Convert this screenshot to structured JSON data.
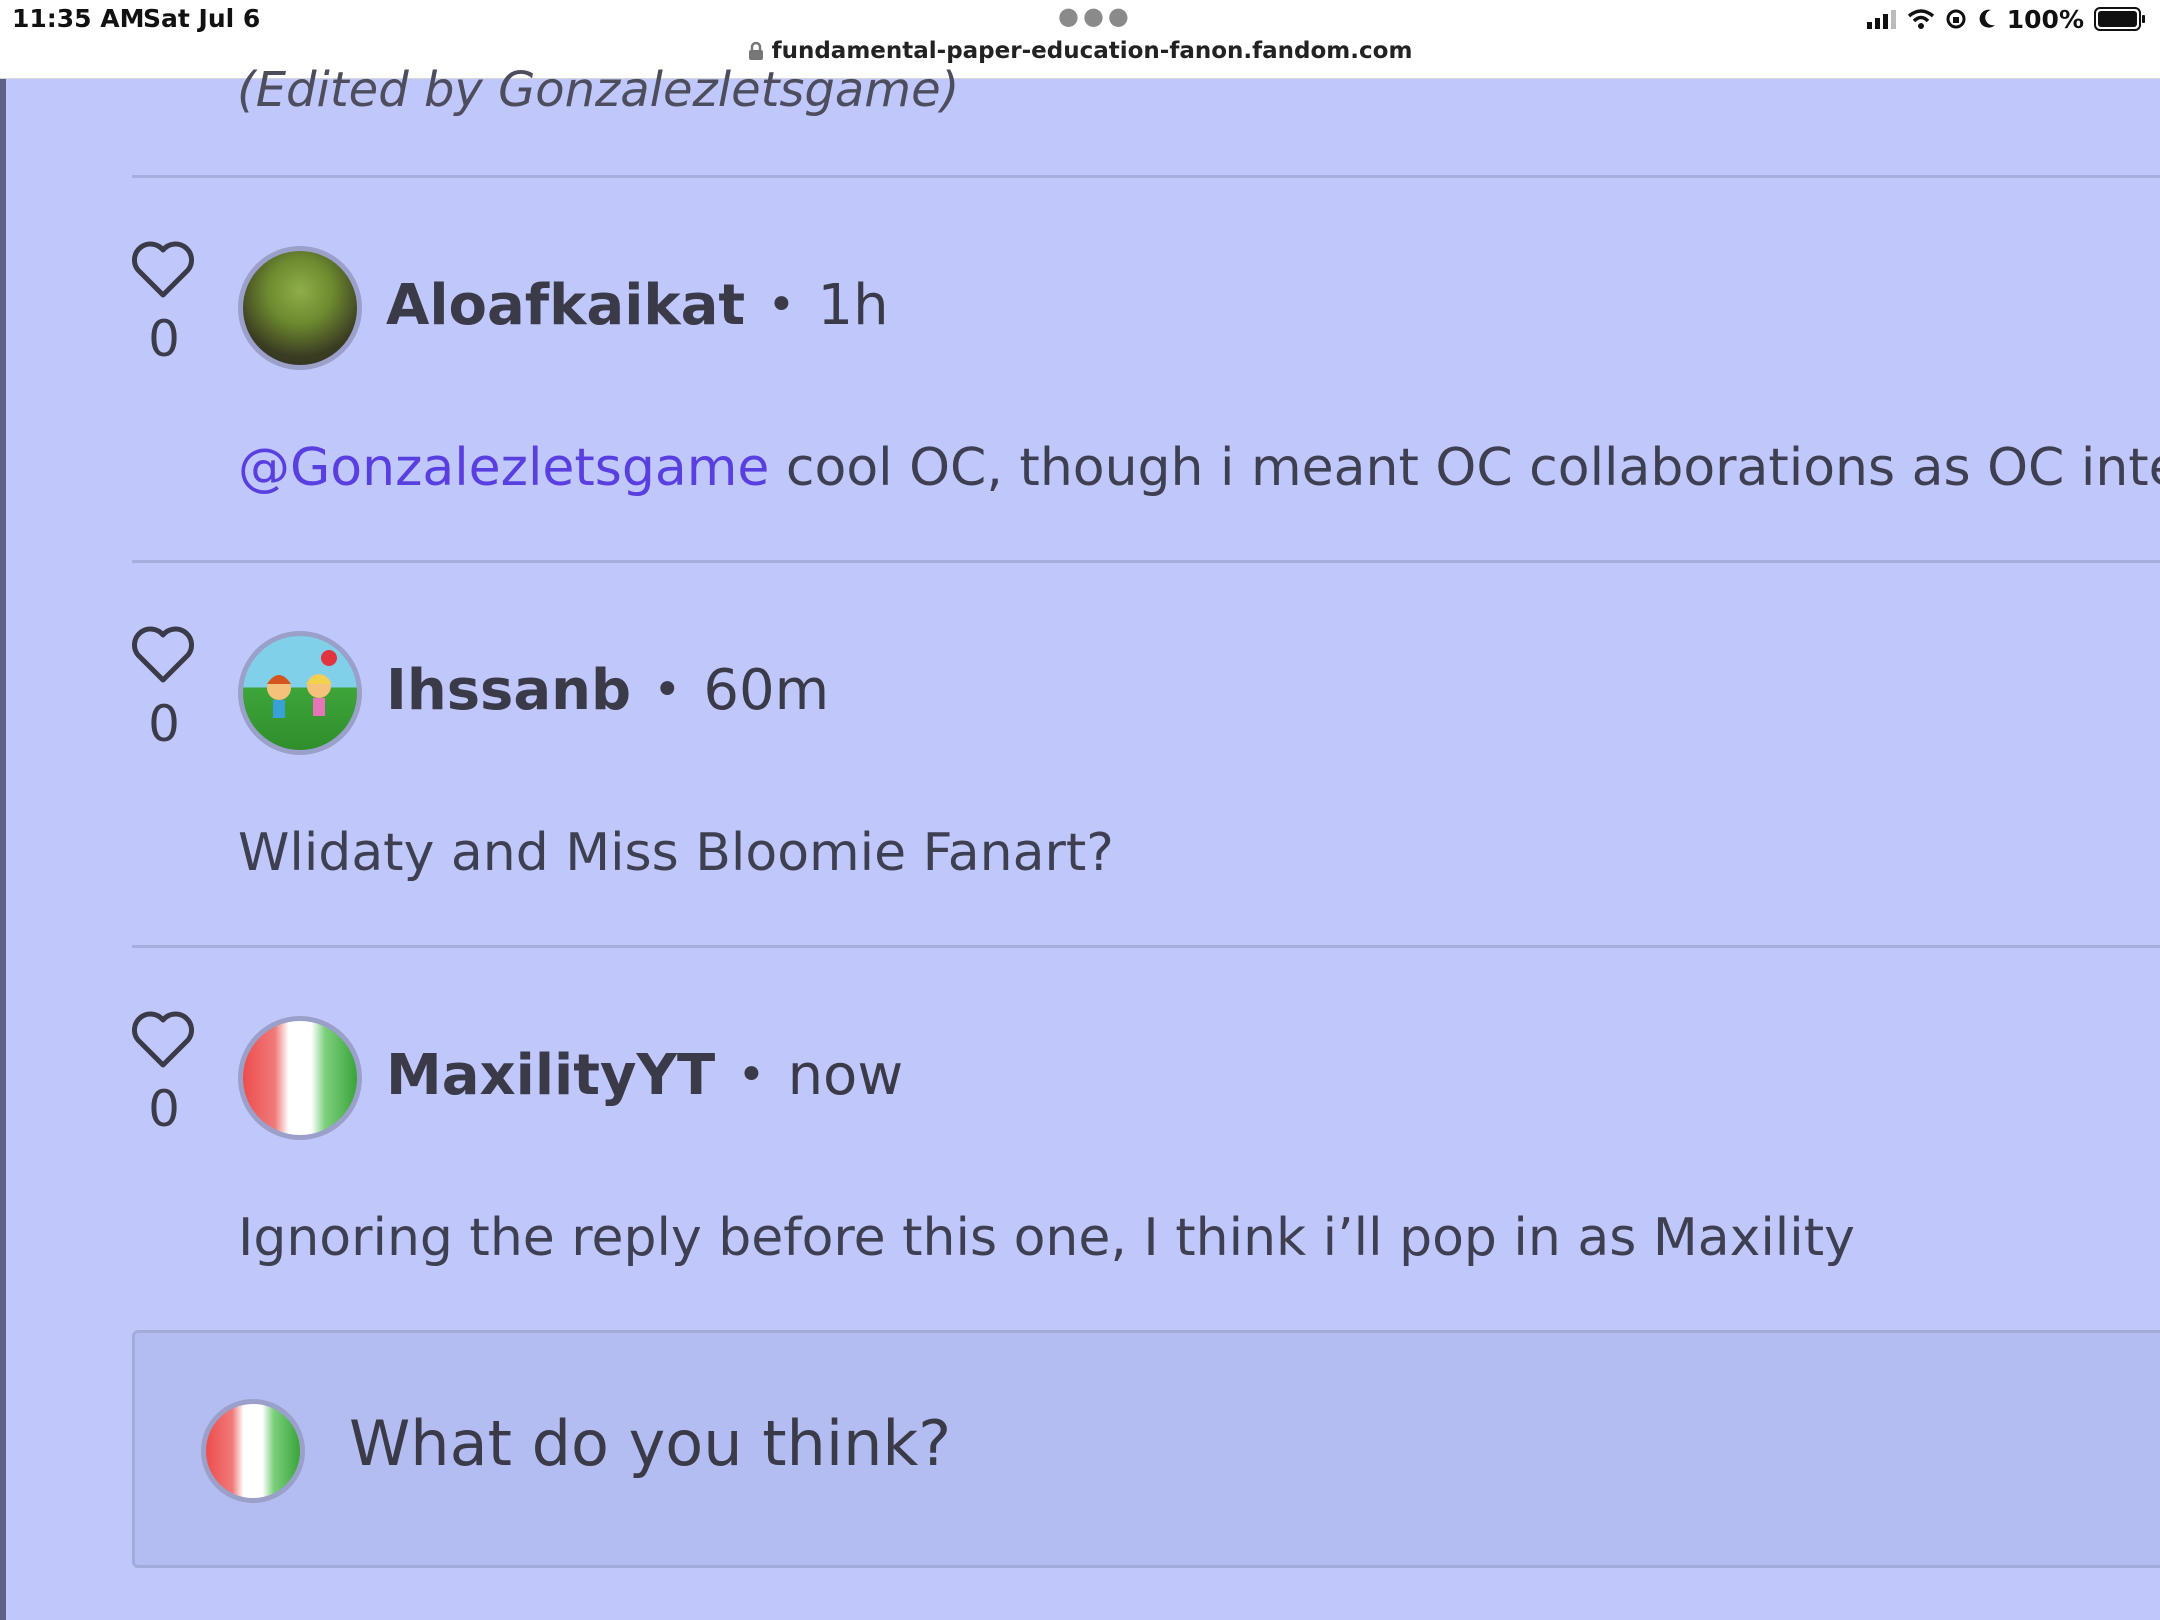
{
  "status_bar": {
    "time": "11:35 AM",
    "date": "Sat Jul 6",
    "battery": "100%"
  },
  "browser": {
    "url": "fundamental-paper-education-fanon.fandom.com"
  },
  "thread": {
    "edited_note": "(Edited by Gonzalezletsgame)",
    "comments": [
      {
        "likes": "0",
        "author": "Aloafkaikat",
        "separator": "•",
        "time": "1h",
        "mention": "@Gonzalezletsgame",
        "text": " cool OC, though i meant OC collaborations as OC intera"
      },
      {
        "likes": "0",
        "author": "Ihssanb",
        "separator": "•",
        "time": "60m",
        "text": "Wlidaty and Miss Bloomie Fanart?"
      },
      {
        "likes": "0",
        "author": "MaxilityYT",
        "separator": "•",
        "time": "now",
        "text": "Ignoring the reply before this one, I think i’ll pop in as Maxility"
      }
    ]
  },
  "composer": {
    "placeholder": "What do you think?"
  },
  "icons": {
    "like": "heart-outline-icon",
    "lock": "lock-icon",
    "signal": "cellular-signal-icon",
    "wifi": "wifi-icon",
    "battery": "battery-icon"
  },
  "colors": {
    "page_bg": "#c0c8fb",
    "mention": "#5a3fe0",
    "composer_bg": "#b4bdf1"
  }
}
